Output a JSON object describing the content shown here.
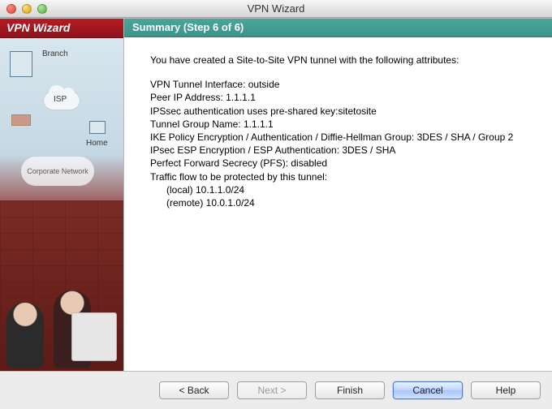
{
  "window": {
    "title": "VPN Wizard"
  },
  "sidebar": {
    "title": "VPN Wizard",
    "labels": {
      "branch": "Branch",
      "isp": "ISP",
      "home": "Home",
      "corporate": "Corporate Network"
    }
  },
  "header": {
    "title": "Summary  (Step 6 of 6)"
  },
  "summary": {
    "intro": "You have created a Site-to-Site VPN tunnel with the following attributes:",
    "lines": {
      "interface": "VPN Tunnel Interface: outside",
      "peer": "Peer IP Address: 1.1.1.1",
      "auth": "IPSsec authentication uses pre-shared key:sitetosite",
      "group": "Tunnel Group Name: 1.1.1.1",
      "ike": "IKE Policy Encryption / Authentication / Diffie-Hellman Group: 3DES / SHA / Group 2",
      "esp": "IPsec ESP Encryption / ESP Authentication: 3DES / SHA",
      "pfs": "Perfect Forward Secrecy (PFS): disabled",
      "traffic": "Traffic flow to be protected by this tunnel:",
      "local": "(local) 10.1.1.0/24",
      "remote": "(remote) 10.0.1.0/24"
    }
  },
  "buttons": {
    "back": "< Back",
    "next": "Next >",
    "finish": "Finish",
    "cancel": "Cancel",
    "help": "Help"
  }
}
